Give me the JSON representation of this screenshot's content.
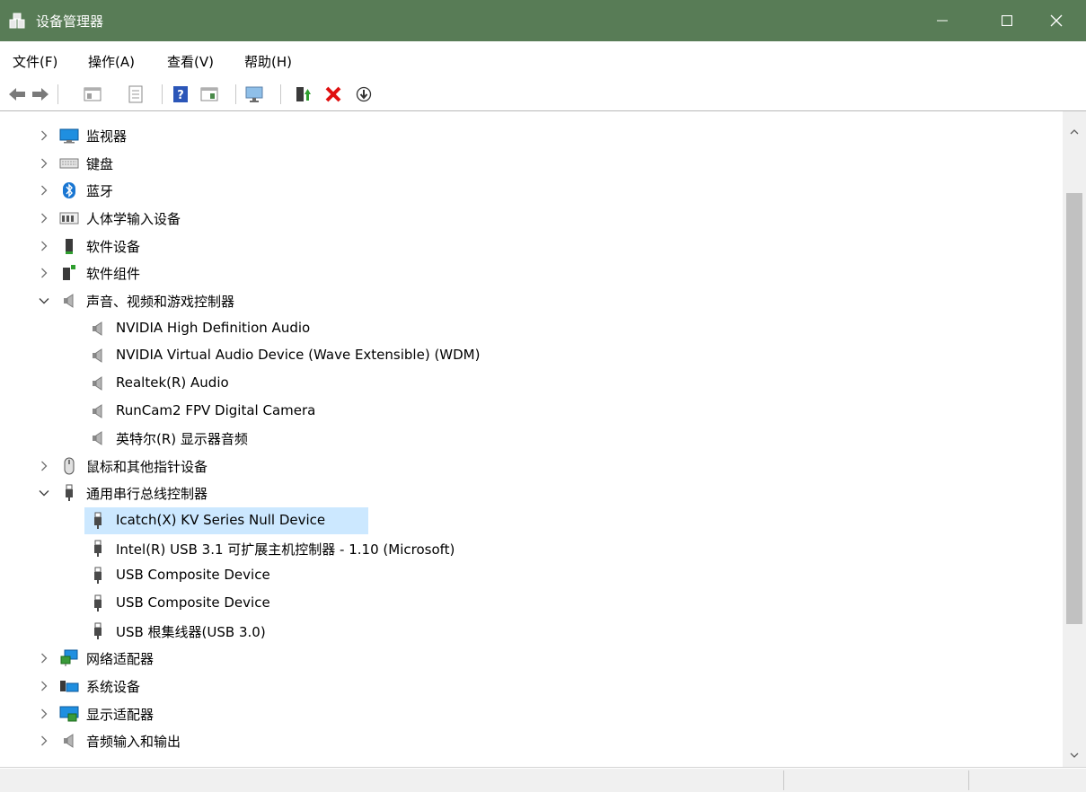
{
  "window": {
    "title": "设备管理器",
    "app_icon": "device-manager-icon",
    "titlebar_color": "#587c56",
    "controls": [
      "minimize-icon",
      "maximize-icon",
      "close-icon"
    ]
  },
  "menu": {
    "file": "文件(F)",
    "action": "操作(A)",
    "view": "查看(V)",
    "help": "帮助(H)"
  },
  "toolbar": {
    "buttons": [
      "back-arrow-icon",
      "forward-arrow-icon",
      "show-hide-console-tree-icon",
      "properties-icon",
      "help-icon",
      "action-pane-icon",
      "scan-hardware-icon",
      "enable-driver-icon",
      "uninstall-device-icon",
      "disable-device-icon"
    ]
  },
  "tree": {
    "selected_color": "#cce8ff",
    "items": [
      {
        "label": "监视器",
        "icon": "monitor-icon",
        "expanded": false,
        "level": 0
      },
      {
        "label": "键盘",
        "icon": "keyboard-icon",
        "expanded": false,
        "level": 0
      },
      {
        "label": "蓝牙",
        "icon": "bluetooth-icon",
        "expanded": false,
        "level": 0
      },
      {
        "label": "人体学输入设备",
        "icon": "hid-icon",
        "expanded": false,
        "level": 0
      },
      {
        "label": "软件设备",
        "icon": "software-device-icon",
        "expanded": false,
        "level": 0
      },
      {
        "label": "软件组件",
        "icon": "software-component-icon",
        "expanded": false,
        "level": 0
      },
      {
        "label": "声音、视频和游戏控制器",
        "icon": "speaker-icon",
        "expanded": true,
        "level": 0
      },
      {
        "label": "NVIDIA High Definition Audio",
        "icon": "speaker-icon",
        "level": 1
      },
      {
        "label": "NVIDIA Virtual Audio Device (Wave Extensible) (WDM)",
        "icon": "speaker-icon",
        "level": 1
      },
      {
        "label": "Realtek(R) Audio",
        "icon": "speaker-icon",
        "level": 1
      },
      {
        "label": "RunCam2 FPV Digital Camera",
        "icon": "speaker-icon",
        "level": 1
      },
      {
        "label": "英特尔(R) 显示器音频",
        "icon": "speaker-icon",
        "level": 1
      },
      {
        "label": "鼠标和其他指针设备",
        "icon": "mouse-icon",
        "expanded": false,
        "level": 0
      },
      {
        "label": "通用串行总线控制器",
        "icon": "usb-icon",
        "expanded": true,
        "level": 0
      },
      {
        "label": "Icatch(X) KV Series Null Device",
        "icon": "usb-icon",
        "level": 1,
        "selected": true
      },
      {
        "label": "Intel(R) USB 3.1 可扩展主机控制器 - 1.10 (Microsoft)",
        "icon": "usb-icon",
        "level": 1
      },
      {
        "label": "USB Composite Device",
        "icon": "usb-icon",
        "level": 1
      },
      {
        "label": "USB Composite Device",
        "icon": "usb-icon",
        "level": 1
      },
      {
        "label": "USB 根集线器(USB 3.0)",
        "icon": "usb-icon",
        "level": 1
      },
      {
        "label": "网络适配器",
        "icon": "network-adapter-icon",
        "expanded": false,
        "level": 0
      },
      {
        "label": "系统设备",
        "icon": "system-device-icon",
        "expanded": false,
        "level": 0
      },
      {
        "label": "显示适配器",
        "icon": "display-adapter-icon",
        "expanded": false,
        "level": 0
      },
      {
        "label": "音频输入和输出",
        "icon": "speaker-icon",
        "expanded": false,
        "level": 0
      }
    ]
  },
  "scrollbar": {
    "position_fraction": 0.3
  }
}
